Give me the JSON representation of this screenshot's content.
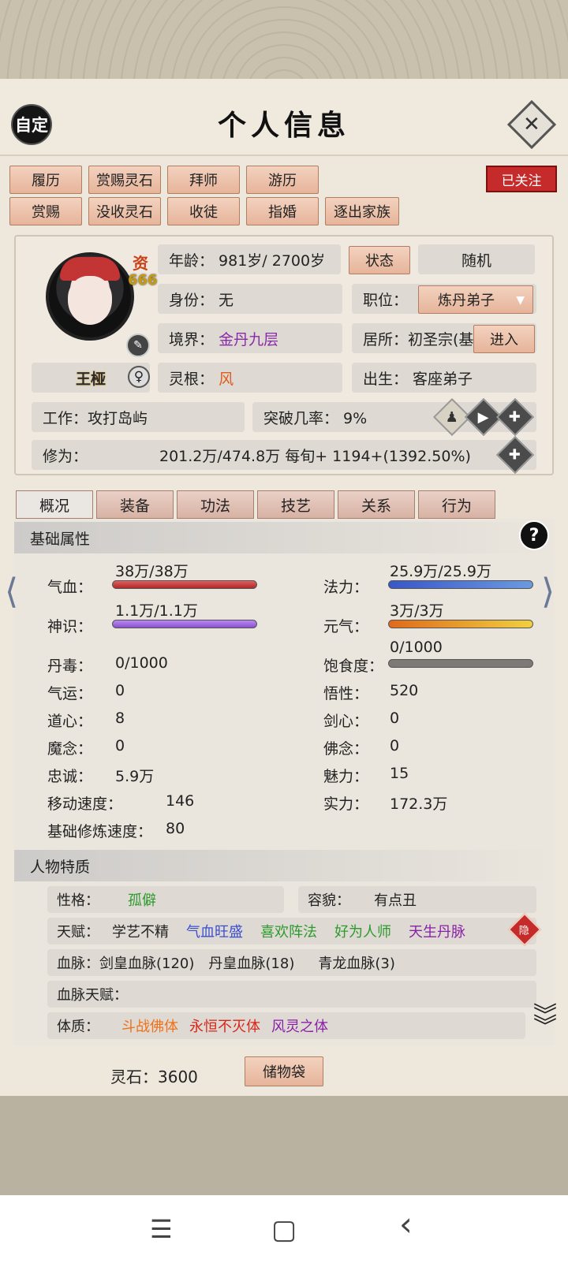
{
  "header": {
    "auto_label": "自定",
    "title": "个人信息",
    "close_label": "✕"
  },
  "actions_row1": [
    "履历",
    "赏赐灵石",
    "拜师",
    "游历"
  ],
  "actions_row2": [
    "赏赐",
    "没收灵石",
    "收徒",
    "指婚",
    "逐出家族"
  ],
  "follow_label": "已关注",
  "profile": {
    "aptitude_label": "资",
    "aptitude_value": "666",
    "name": "王桠",
    "gender_icon": "♀",
    "age": "年龄：  981岁/ 2700岁",
    "status_button": "状态",
    "random_button": "随机",
    "identity": "身份：  无",
    "position_label": "职位：",
    "position_value": "炼丹弟子",
    "realm_label": "境界：",
    "realm_value": "金丹九层",
    "residence": "居所：初圣宗(基",
    "enter_button": "进入",
    "root_label": "灵根：",
    "root_value": "风",
    "birth": "出生：  客座弟子",
    "work": "工作：攻打岛屿",
    "breakthrough": "突破几率：  9%",
    "cultivation_label": "修为：",
    "cultivation_value": "201.2万/474.8万  每旬+  1194+(1392.50%)"
  },
  "tabs": [
    "概况",
    "装备",
    "功法",
    "技艺",
    "关系",
    "行为"
  ],
  "basic": {
    "heading": "基础属性",
    "help_icon": "?",
    "hp_label": "气血：",
    "hp_value": "38万/38万",
    "mana_label": "法力：",
    "mana_value": "25.9万/25.9万",
    "spirit_label": "神识：",
    "spirit_value": "1.1万/1.1万",
    "vigor_label": "元气：",
    "vigor_value": "3万/3万",
    "poison_label": "丹毒：",
    "poison_value": "0/1000",
    "satiety_label": "饱食度：",
    "satiety_value": "0/1000",
    "luck_label": "气运：",
    "luck_value": "0",
    "insight_label": "悟性：",
    "insight_value": "520",
    "dao_label": "道心：",
    "dao_value": "8",
    "sword_label": "剑心：",
    "sword_value": "0",
    "demon_label": "魔念：",
    "demon_value": "0",
    "buddha_label": "佛念：",
    "buddha_value": "0",
    "loyalty_label": "忠诚：",
    "loyalty_value": "5.9万",
    "charm_label": "魅力：",
    "charm_value": "15",
    "speed_label": "移动速度：",
    "speed_value": "146",
    "power_label": "实力：",
    "power_value": "172.3万",
    "train_label": "基础修炼速度：",
    "train_value": "80"
  },
  "traits": {
    "heading": "人物特质",
    "personality_label": "性格：",
    "personality_value": "孤僻",
    "looks_label": "容貌：",
    "looks_value": "有点丑",
    "talent_label": "天赋：",
    "talents": [
      "学艺不精",
      "气血旺盛",
      "喜欢阵法",
      "好为人师",
      "天生丹脉"
    ],
    "hidden_label": "隐",
    "bloodline_label": "血脉：",
    "bloodlines": [
      "剑皇血脉(120)",
      "丹皇血脉(18)",
      "青龙血脉(3)"
    ],
    "bloodline_talent_label": "血脉天赋：",
    "physique_label": "体质：",
    "physiques": [
      "斗战佛体",
      "永恒不灭体",
      "风灵之体"
    ]
  },
  "footer": {
    "stones": "灵石：3600",
    "bag_button": "储物袋"
  },
  "system_nav": {
    "menu": "☰",
    "home": "▢",
    "back": "‹"
  },
  "colors": {
    "accent_red": "#c62b2b",
    "hp_bar": "#c83a3a",
    "mana_bar": "#4a6fd0",
    "spirit_bar": "#9a5fd8",
    "vigor_bar": "#e88a2a"
  }
}
